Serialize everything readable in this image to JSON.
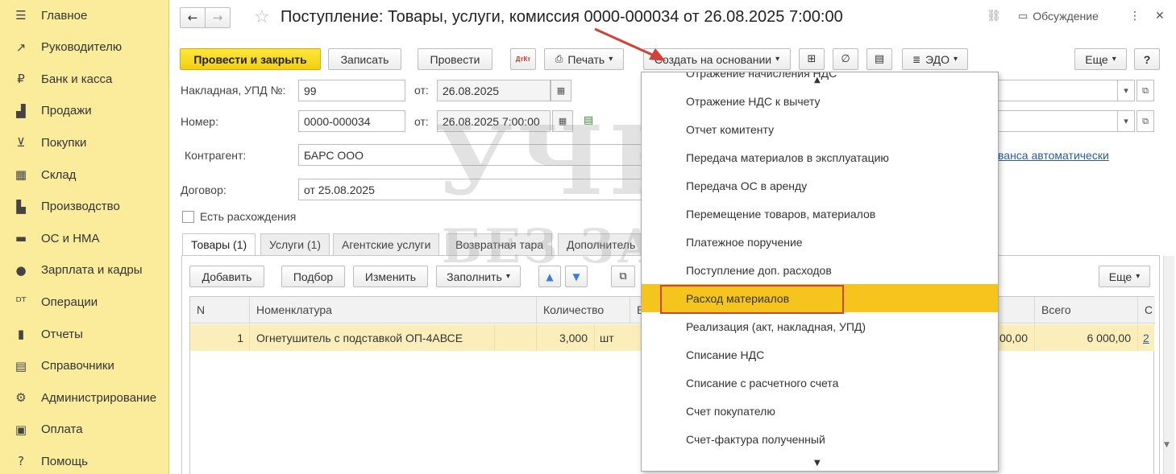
{
  "sidebar": {
    "items": [
      {
        "label": "Главное",
        "icon": "menu-icon",
        "glyph": "☰"
      },
      {
        "label": "Руководителю",
        "icon": "trend-icon",
        "glyph": "↗"
      },
      {
        "label": "Банк и касса",
        "icon": "coin-icon",
        "glyph": "₽"
      },
      {
        "label": "Продажи",
        "icon": "bag-icon",
        "glyph": "▟"
      },
      {
        "label": "Покупки",
        "icon": "cart-icon",
        "glyph": "⊻"
      },
      {
        "label": "Склад",
        "icon": "warehouse-icon",
        "glyph": "▦"
      },
      {
        "label": "Производство",
        "icon": "factory-icon",
        "glyph": "▙"
      },
      {
        "label": "ОС и НМА",
        "icon": "truck-icon",
        "glyph": "▬"
      },
      {
        "label": "Зарплата и кадры",
        "icon": "person-icon",
        "glyph": "●"
      },
      {
        "label": "Операции",
        "icon": "dt-kt-icon",
        "glyph": "ᴰᵀ"
      },
      {
        "label": "Отчеты",
        "icon": "bar-chart-icon",
        "glyph": "▮"
      },
      {
        "label": "Справочники",
        "icon": "book-icon",
        "glyph": "▤"
      },
      {
        "label": "Администрирование",
        "icon": "gear-icon",
        "glyph": "⚙"
      },
      {
        "label": "Оплата",
        "icon": "wallet-icon",
        "glyph": "▣"
      },
      {
        "label": "Помощь",
        "icon": "help-icon",
        "glyph": "?"
      }
    ]
  },
  "header": {
    "back_glyph": "←",
    "forward_glyph": "→",
    "star_glyph": "☆",
    "title": "Поступление: Товары, услуги, комиссия 0000-000034 от 26.08.2025 7:00:00",
    "link_glyph": "⛓",
    "discussion_label": "Обсуждение",
    "more_glyph": "⋮",
    "close_glyph": "✕"
  },
  "toolbar": {
    "post_close_label": "Провести и закрыть",
    "save_label": "Записать",
    "post_label": "Провести",
    "dtkt_glyph": "ДтКт",
    "print_label": "Печать",
    "create_based_label": "Создать на основании",
    "edo_label": "ЭДО",
    "more_label": "Еще",
    "help_label": "?"
  },
  "form": {
    "invoice_label": "Накладная, УПД №:",
    "invoice_value": "99",
    "from_label": "от:",
    "invoice_date": "26.08.2025",
    "number_label": "Номер:",
    "number_value": "0000-000034",
    "number_date": "26.08.2025  7:00:00",
    "contractor_label": "Контрагент:",
    "contractor_value": "БАРС ООО",
    "contract_label": "Договор:",
    "contract_value": "от 25.08.2025",
    "discrepancy_label": "Есть расхождения",
    "advance_link": "ванса автоматически"
  },
  "tabs": [
    {
      "label": "Товары (1)"
    },
    {
      "label": "Услуги (1)"
    },
    {
      "label": "Агентские услуги"
    },
    {
      "label": "Возвратная тара"
    },
    {
      "label": "Дополнитель"
    }
  ],
  "table_toolbar": {
    "add_label": "Добавить",
    "pick_label": "Подбор",
    "edit_label": "Изменить",
    "fill_label": "Заполнить",
    "up_glyph": "▲",
    "down_glyph": "▼",
    "more_label": "Еще"
  },
  "table": {
    "columns": {
      "n": "N",
      "nomenclature": "Номенклатура",
      "quantity": "Количество",
      "unit": "Е",
      "sum": "",
      "total": "Всего",
      "vat": "С"
    },
    "rows": [
      {
        "n": "1",
        "nomenclature": "Огнетушитель с подставкой ОП-4АВСЕ",
        "quantity": "3,000",
        "unit": "шт",
        "sum": "00,00",
        "total": "6 000,00",
        "vat": "2"
      }
    ]
  },
  "menu": {
    "items": [
      {
        "label": "Отражение начисления НДС"
      },
      {
        "label": "Отражение НДС к вычету"
      },
      {
        "label": "Отчет комитенту"
      },
      {
        "label": "Передача материалов в эксплуатацию"
      },
      {
        "label": "Передача ОС в аренду"
      },
      {
        "label": "Перемещение товаров, материалов"
      },
      {
        "label": "Платежное поручение"
      },
      {
        "label": "Поступление доп. расходов"
      },
      {
        "label": "Расход материалов"
      },
      {
        "label": "Реализация (акт, накладная, УПД)"
      },
      {
        "label": "Списание НДС"
      },
      {
        "label": "Списание с расчетного счета"
      },
      {
        "label": "Счет покупателю"
      },
      {
        "label": "Счет-фактура полученный"
      }
    ],
    "selected_index": 8,
    "highlight_color": "#f5c41d",
    "annotation_color": "#d0433a"
  },
  "watermark": {
    "line1": "УЧЕТ",
    "line2": "БЕЗ ЗАБОТ"
  }
}
